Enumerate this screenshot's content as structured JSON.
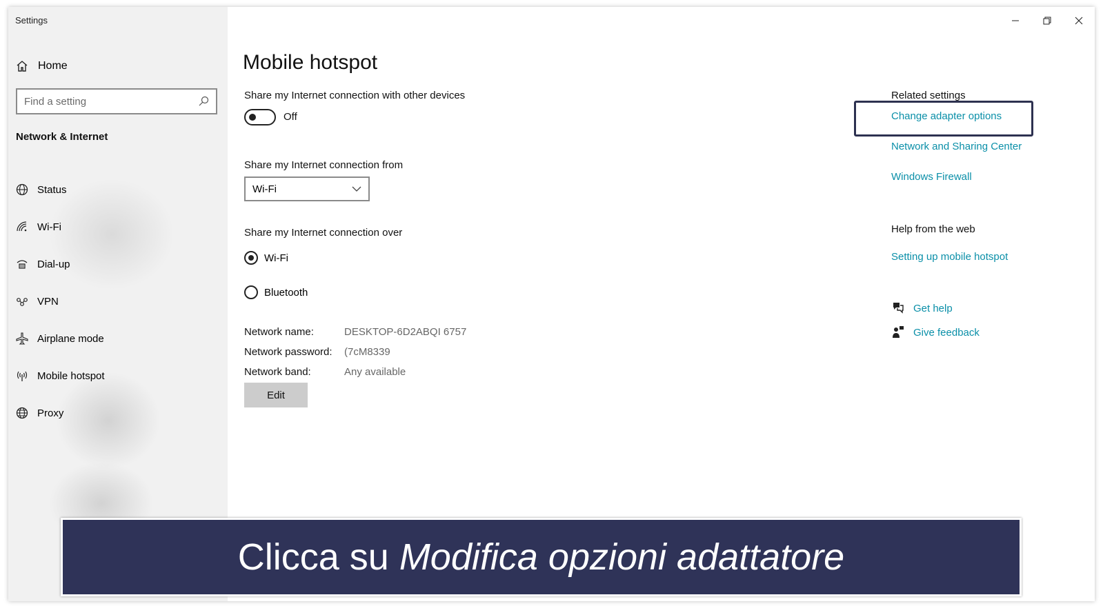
{
  "window": {
    "app_title": "Settings",
    "caption": {
      "minimize": "minimize-icon",
      "restore": "restore-icon",
      "close": "close-icon"
    }
  },
  "sidebar": {
    "home_label": "Home",
    "search_placeholder": "Find a setting",
    "section_title": "Network & Internet",
    "items": [
      {
        "label": "Status",
        "icon": "globe-status-icon"
      },
      {
        "label": "Wi-Fi",
        "icon": "wifi-icon"
      },
      {
        "label": "Dial-up",
        "icon": "dialup-icon"
      },
      {
        "label": "VPN",
        "icon": "vpn-icon"
      },
      {
        "label": "Airplane mode",
        "icon": "airplane-icon"
      },
      {
        "label": "Mobile hotspot",
        "icon": "hotspot-icon"
      },
      {
        "label": "Proxy",
        "icon": "globe-icon"
      }
    ]
  },
  "main": {
    "title": "Mobile hotspot",
    "share_with_label": "Share my Internet connection with other devices",
    "toggle_state": "Off",
    "share_from_label": "Share my Internet connection from",
    "share_from_value": "Wi-Fi",
    "share_over_label": "Share my Internet connection over",
    "share_over_options": [
      {
        "label": "Wi-Fi",
        "selected": true
      },
      {
        "label": "Bluetooth",
        "selected": false
      }
    ],
    "info": [
      {
        "key": "Network name:",
        "value": "DESKTOP-6D2ABQI 6757"
      },
      {
        "key": "Network password:",
        "value": "(7cM8339"
      },
      {
        "key": "Network band:",
        "value": "Any available"
      }
    ],
    "edit_label": "Edit"
  },
  "related": {
    "heading": "Related settings",
    "links": [
      "Change adapter options",
      "Network and Sharing Center",
      "Windows Firewall"
    ],
    "help_heading": "Help from the web",
    "help_link": "Setting up mobile hotspot",
    "get_help": "Get help",
    "give_feedback": "Give feedback"
  },
  "banner": {
    "prefix": "Clicca su ",
    "emphasis": "Modifica opzioni adattatore"
  },
  "colors": {
    "link": "#0a8fa8",
    "banner_bg": "#2f3358",
    "highlight_border": "#2d3150"
  }
}
